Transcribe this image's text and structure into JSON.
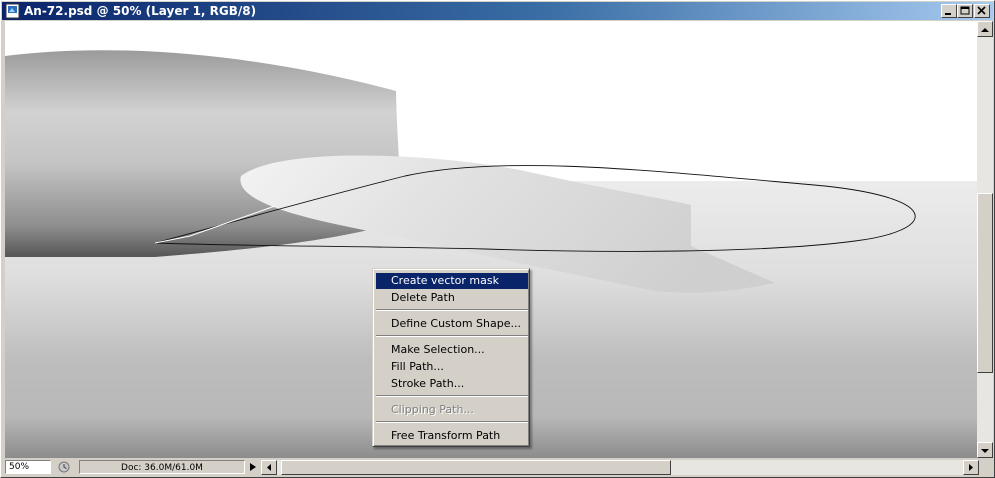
{
  "window": {
    "title": "An-72.psd @ 50% (Layer 1, RGB/8)"
  },
  "context_menu": {
    "items": [
      {
        "label": "Create vector mask",
        "state": "highlighted"
      },
      {
        "label": "Delete Path",
        "state": "normal"
      },
      {
        "label": "Define Custom Shape...",
        "state": "normal"
      },
      {
        "label": "Make Selection...",
        "state": "normal"
      },
      {
        "label": "Fill Path...",
        "state": "normal"
      },
      {
        "label": "Stroke Path...",
        "state": "normal"
      },
      {
        "label": "Clipping Path...",
        "state": "disabled"
      },
      {
        "label": "Free Transform Path",
        "state": "normal"
      }
    ]
  },
  "status_bar": {
    "zoom": "50%",
    "doc_info": "Doc: 36.0M/61.0M"
  },
  "colors": {
    "titlebar_start": "#0a246a",
    "titlebar_end": "#a6caf0",
    "menu_highlight": "#0a246a"
  }
}
